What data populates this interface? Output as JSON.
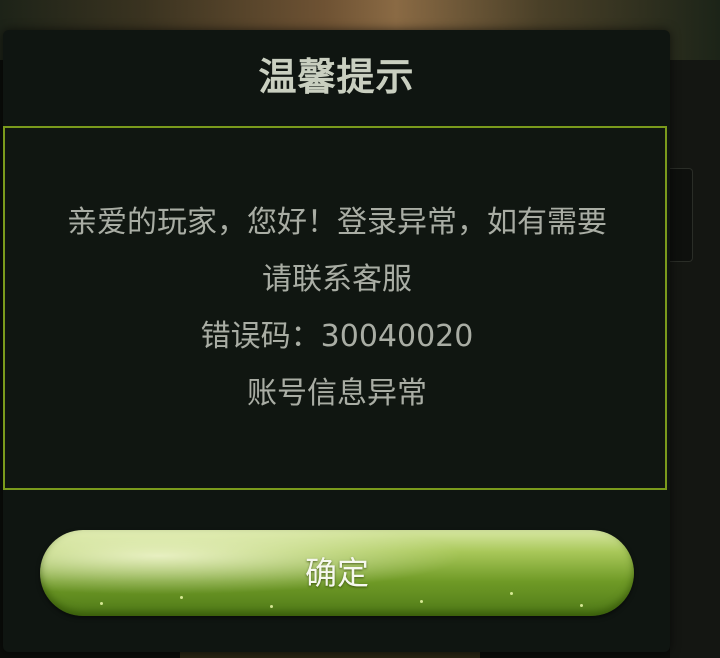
{
  "dialog": {
    "title": "温馨提示",
    "message_lines": [
      "亲爱的玩家，您好！登录异常，如有需要",
      "请联系客服",
      "错误码：30040020",
      "账号信息异常"
    ],
    "confirm_label": "确定"
  },
  "colors": {
    "modal_bg": "#0f1511",
    "border_accent": "#7a9a1c",
    "title_text": "#c9cfc0",
    "message_text": "#a9ada4",
    "button_green": "#6f9a26"
  }
}
